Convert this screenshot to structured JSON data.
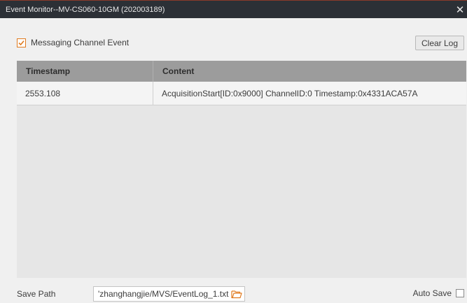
{
  "window": {
    "title": "Event Monitor--MV-CS060-10GM (202003189)",
    "close_icon": "close-icon"
  },
  "options": {
    "messaging_channel_label": "Messaging Channel Event",
    "messaging_channel_checked": true,
    "clear_log_label": "Clear Log"
  },
  "table": {
    "columns": [
      "Timestamp",
      "Content"
    ],
    "rows": [
      {
        "timestamp": "2553.108",
        "content": "AcquisitionStart[ID:0x9000] ChannelID:0 Timestamp:0x4331ACA57A"
      }
    ]
  },
  "footer": {
    "save_path_label": "Save Path",
    "save_path_value": "'zhanghangjie/MVS/EventLog_1.txt",
    "folder_icon": "folder-open-icon",
    "auto_save_label": "Auto Save",
    "auto_save_checked": false
  },
  "colors": {
    "accent": "#e07a1e",
    "titlebar_bg": "#2c3036",
    "table_header_bg": "#9c9c9c"
  }
}
